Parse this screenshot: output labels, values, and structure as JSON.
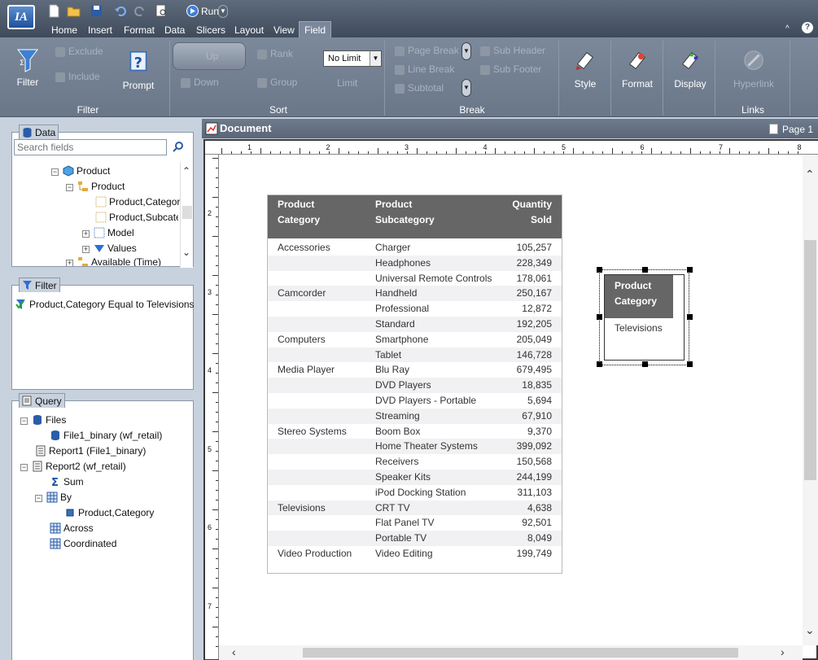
{
  "app": {
    "logo_text": "IA",
    "run_label": "Run"
  },
  "tabs": [
    "Home",
    "Insert",
    "Format",
    "Data",
    "Slicers",
    "Layout",
    "View",
    "Field"
  ],
  "active_tab": "Field",
  "ribbon": {
    "filter_group": {
      "label": "Filter",
      "filter": "Filter",
      "exclude": "Exclude",
      "include": "Include",
      "prompt": "Prompt"
    },
    "sort_group": {
      "label": "Sort",
      "up": "Up",
      "down": "Down",
      "rank": "Rank",
      "group": "Group",
      "limit_value": "No Limit",
      "limit": "Limit"
    },
    "break_group": {
      "label": "Break",
      "page_break": "Page Break",
      "line_break": "Line Break",
      "subtotal": "Subtotal",
      "sub_header": "Sub Header",
      "sub_footer": "Sub Footer"
    },
    "style": "Style",
    "format": "Format",
    "display": "Display",
    "links_group": {
      "label": "Links",
      "hyperlink": "Hyperlink"
    }
  },
  "data_panel": {
    "title": "Data",
    "search_placeholder": "Search fields",
    "tree": [
      "Product",
      "Product",
      "Product,Category",
      "Product,Subcategory",
      "Model",
      "Values",
      "Available (Time)"
    ]
  },
  "filter_panel": {
    "title": "Filter",
    "item": "Product,Category Equal to Televisions"
  },
  "query_panel": {
    "title": "Query",
    "items": [
      "Files",
      "File1_binary (wf_retail)",
      "Report1 (File1_binary)",
      "Report2 (wf_retail)",
      "Sum",
      "By",
      "Product,Category",
      "Across",
      "Coordinated"
    ]
  },
  "document": {
    "title": "Document",
    "page_label": "Page 1"
  },
  "ruler_h": [
    "1",
    "2",
    "3",
    "4",
    "5",
    "6",
    "7",
    "8"
  ],
  "ruler_v": [
    "2",
    "3",
    "4",
    "5",
    "6",
    "7"
  ],
  "report": {
    "headers": {
      "c1": [
        "Product",
        "Category"
      ],
      "c2": [
        "Product",
        "Subcategory"
      ],
      "c3": [
        "Quantity",
        "Sold"
      ]
    },
    "rows": [
      [
        "Accessories",
        "Charger",
        "105,257"
      ],
      [
        "",
        "Headphones",
        "228,349"
      ],
      [
        "",
        "Universal Remote Controls",
        "178,061"
      ],
      [
        "Camcorder",
        "Handheld",
        "250,167"
      ],
      [
        "",
        "Professional",
        "12,872"
      ],
      [
        "",
        "Standard",
        "192,205"
      ],
      [
        "Computers",
        "Smartphone",
        "205,049"
      ],
      [
        "",
        "Tablet",
        "146,728"
      ],
      [
        "Media Player",
        "Blu Ray",
        "679,495"
      ],
      [
        "",
        "DVD Players",
        "18,835"
      ],
      [
        "",
        "DVD Players - Portable",
        "5,694"
      ],
      [
        "",
        "Streaming",
        "67,910"
      ],
      [
        "Stereo Systems",
        "Boom Box",
        "9,370"
      ],
      [
        "",
        "Home Theater Systems",
        "399,092"
      ],
      [
        "",
        "Receivers",
        "150,568"
      ],
      [
        "",
        "Speaker Kits",
        "244,199"
      ],
      [
        "",
        "iPod Docking Station",
        "311,103"
      ],
      [
        "Televisions",
        "CRT TV",
        "4,638"
      ],
      [
        "",
        "Flat Panel TV",
        "92,501"
      ],
      [
        "",
        "Portable TV",
        "8,049"
      ],
      [
        "Video Production",
        "Video Editing",
        "199,749"
      ]
    ]
  },
  "selected_element": {
    "header": [
      "Product",
      "Category"
    ],
    "value": "Televisions"
  }
}
